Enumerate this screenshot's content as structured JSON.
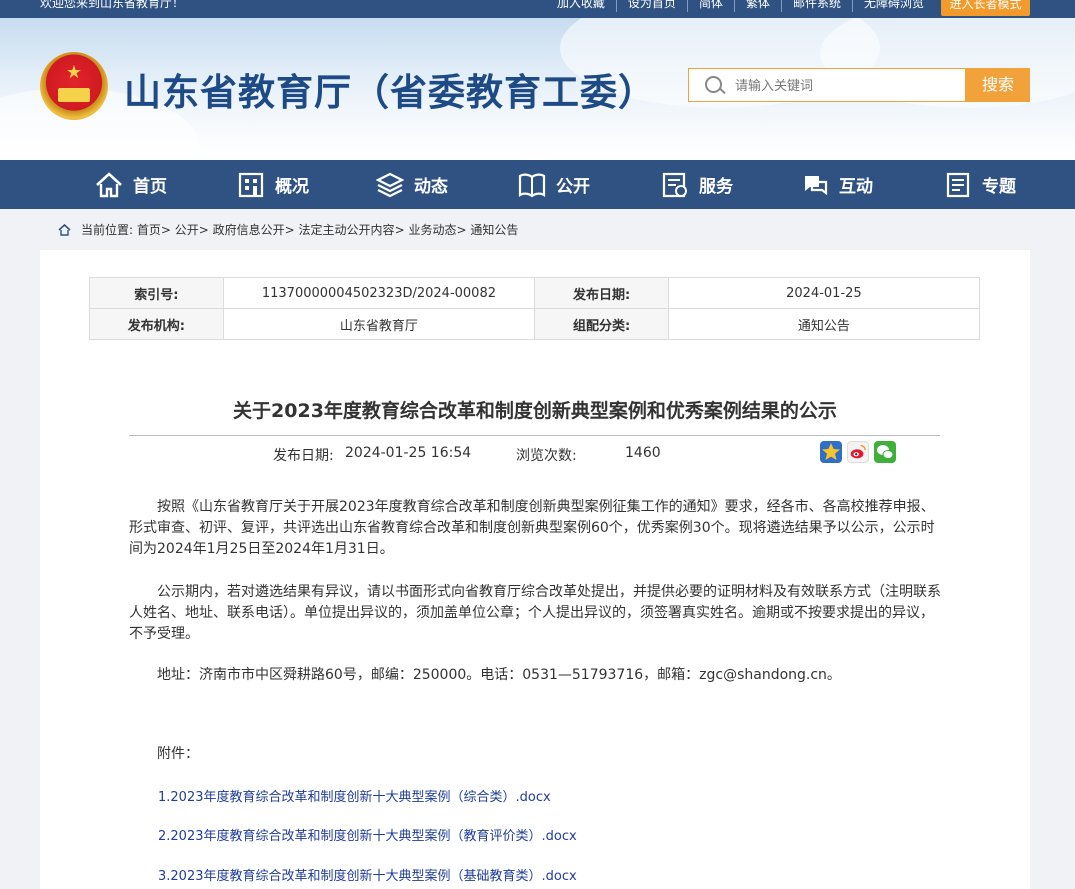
{
  "topbar": {
    "welcome": "欢迎您来到山东省教育厅！",
    "links": [
      "加入收藏",
      "设为首页",
      "简体",
      "繁体",
      "邮件系统",
      "无障碍浏览"
    ],
    "elder_mode": "进入长者模式"
  },
  "header": {
    "site_title": "山东省教育厅（省委教育工委）",
    "search_placeholder": "请输入关键词",
    "search_button": "搜索"
  },
  "nav": [
    {
      "label": "首页",
      "icon": "home-icon"
    },
    {
      "label": "概况",
      "icon": "building-icon"
    },
    {
      "label": "动态",
      "icon": "layers-icon"
    },
    {
      "label": "公开",
      "icon": "book-icon"
    },
    {
      "label": "服务",
      "icon": "service-icon"
    },
    {
      "label": "互动",
      "icon": "chat-icon"
    },
    {
      "label": "专题",
      "icon": "document-icon"
    }
  ],
  "breadcrumb": {
    "prefix": "当前位置:",
    "path": [
      "首页",
      "公开",
      "政府信息公开",
      "法定主动公开内容",
      "业务动态",
      "通知公告"
    ]
  },
  "meta": {
    "index_label": "索引号:",
    "index_value": "11370000004502323D/2024-00082",
    "date_label": "发布日期:",
    "date_value": "2024-01-25",
    "org_label": "发布机构:",
    "org_value": "山东省教育厅",
    "category_label": "组配分类:",
    "category_value": "通知公告"
  },
  "article": {
    "title": "关于2023年度教育综合改革和制度创新典型案例和优秀案例结果的公示",
    "publish_label": "发布日期:",
    "publish_value": "2024-01-25 16:54",
    "views_label": "浏览次数:",
    "views_value": "1460",
    "paragraphs": [
      "按照《山东省教育厅关于开展2023年度教育综合改革和制度创新典型案例征集工作的通知》要求，经各市、各高校推荐申报、形式审查、初评、复评，共评选出山东省教育综合改革和制度创新典型案例60个，优秀案例30个。现将遴选结果予以公示，公示时间为2024年1月25日至2024年1月31日。",
      "公示期内，若对遴选结果有异议，请以书面形式向省教育厅综合改革处提出，并提供必要的证明材料及有效联系方式（注明联系人姓名、地址、联系电话）。单位提出异议的，须加盖单位公章；个人提出异议的，须签署真实姓名。逾期或不按要求提出的异议，不予受理。",
      "地址：济南市市中区舜耕路60号，邮编：250000。电话：0531—51793716，邮箱：zgc@shandong.cn。",
      "附件："
    ],
    "attachments": [
      "1.2023年度教育综合改革和制度创新十大典型案例（综合类）.docx",
      "2.2023年度教育综合改革和制度创新十大典型案例（教育评价类）.docx",
      "3.2023年度教育综合改革和制度创新十大典型案例（基础教育类）.docx"
    ]
  },
  "colors": {
    "nav_bg": "#2f5283",
    "accent": "#f2a23a",
    "title_blue": "#1e4a86",
    "link": "#1f3d99"
  }
}
